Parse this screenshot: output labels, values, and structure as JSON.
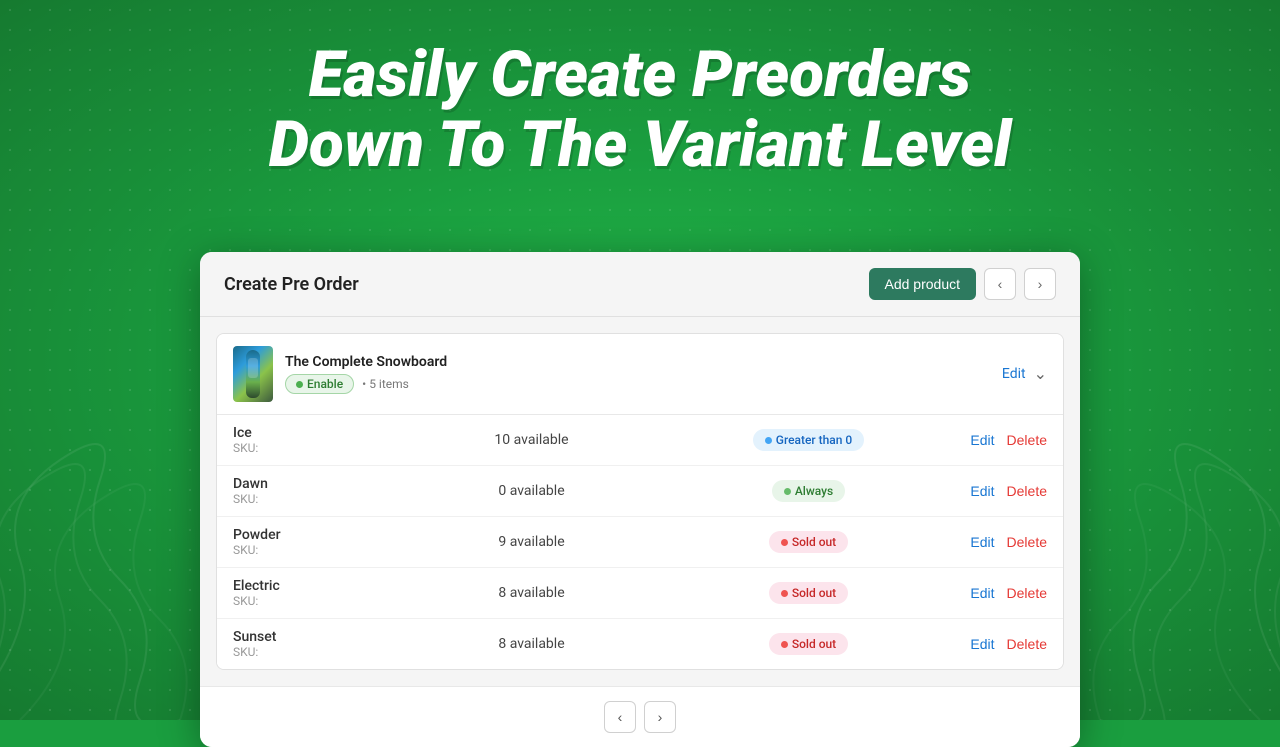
{
  "background": {
    "color": "#1a9e3f"
  },
  "header": {
    "line1": "Easily Create Preorders",
    "line2": "Down To The Variant Level"
  },
  "card": {
    "title": "Create Pre Order",
    "add_product_label": "Add product",
    "nav_prev": "‹",
    "nav_next": "›",
    "product": {
      "name": "The Complete Snowboard",
      "status_label": "Enable",
      "items_label": "5 items",
      "edit_label": "Edit",
      "collapse_icon": "▲"
    },
    "variants": [
      {
        "name": "Ice",
        "sku_label": "SKU:",
        "sku_value": "",
        "available": "10 available",
        "badge_type": "greater-than",
        "badge_label": "Greater than 0",
        "edit_label": "Edit",
        "delete_label": "Delete"
      },
      {
        "name": "Dawn",
        "sku_label": "SKU:",
        "sku_value": "",
        "available": "0 available",
        "badge_type": "always",
        "badge_label": "Always",
        "edit_label": "Edit",
        "delete_label": "Delete"
      },
      {
        "name": "Powder",
        "sku_label": "SKU:",
        "sku_value": "",
        "available": "9 available",
        "badge_type": "sold-out",
        "badge_label": "Sold out",
        "edit_label": "Edit",
        "delete_label": "Delete"
      },
      {
        "name": "Electric",
        "sku_label": "SKU:",
        "sku_value": "",
        "available": "8 available",
        "badge_type": "sold-out",
        "badge_label": "Sold out",
        "edit_label": "Edit",
        "delete_label": "Delete"
      },
      {
        "name": "Sunset",
        "sku_label": "SKU:",
        "sku_value": "",
        "available": "8 available",
        "badge_type": "sold-out",
        "badge_label": "Sold out",
        "edit_label": "Edit",
        "delete_label": "Delete"
      }
    ],
    "pagination": {
      "prev": "‹",
      "next": "›"
    }
  }
}
